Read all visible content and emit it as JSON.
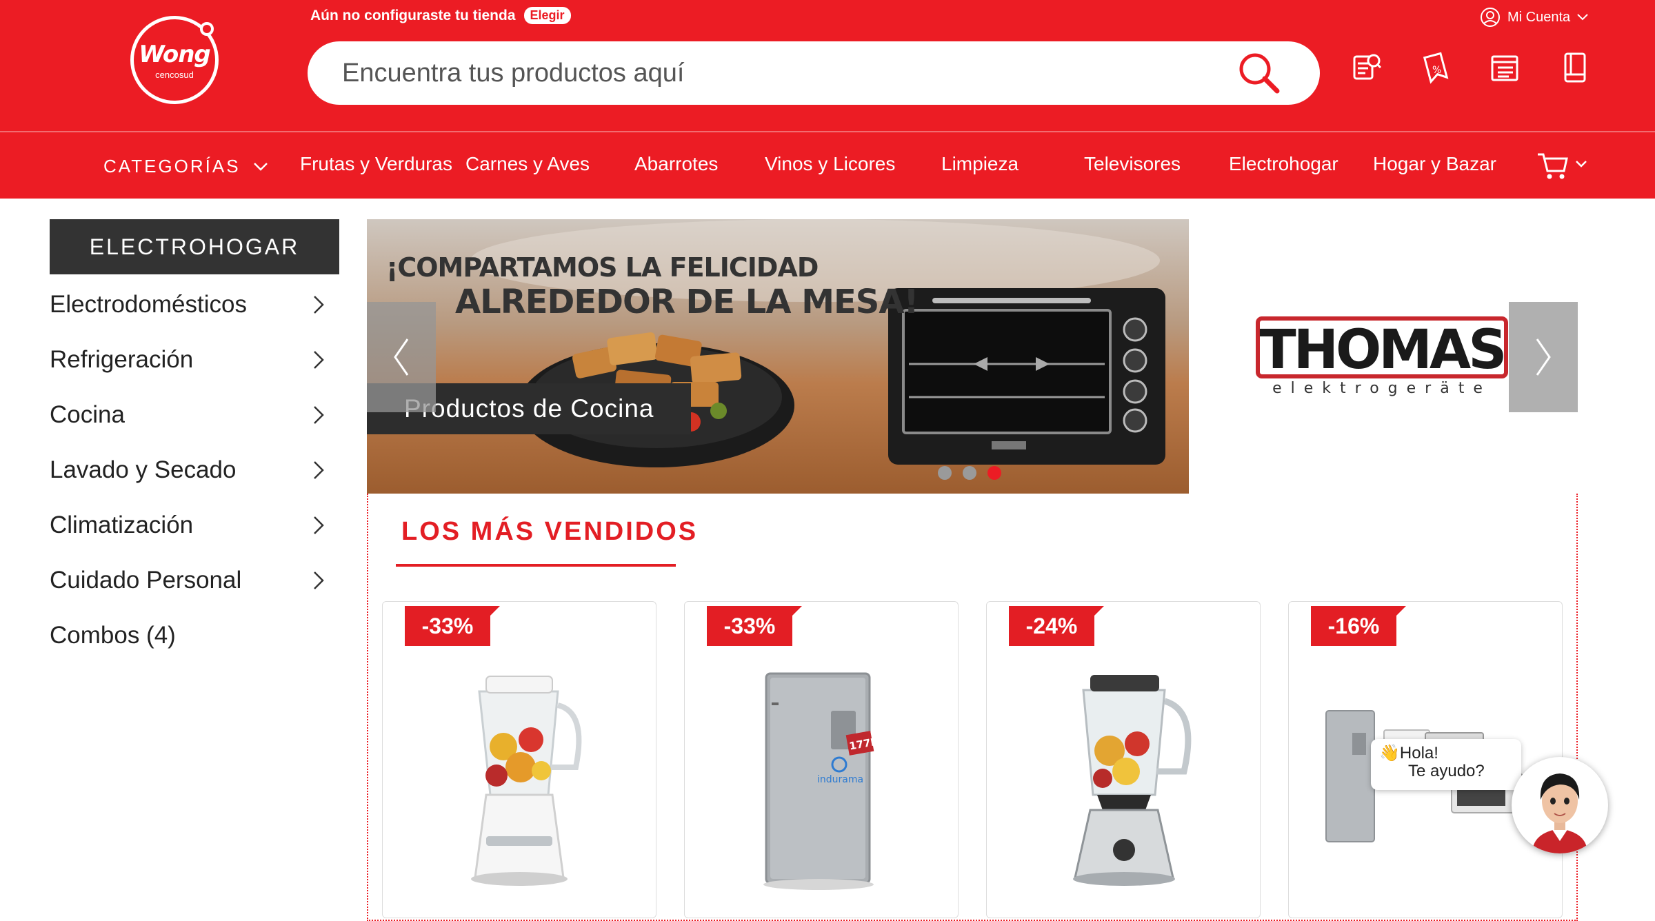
{
  "header": {
    "logo_name": "Wong",
    "logo_sub": "cencosud",
    "store_message": "Aún no configuraste tu tienda",
    "store_button": "Elegir",
    "account_label": "Mi Cuenta",
    "search_placeholder": "Encuentra tus productos aquí",
    "icons": [
      "search-icon",
      "quick-list-icon",
      "offers-icon",
      "orders-icon",
      "catalog-icon"
    ]
  },
  "nav": {
    "categories_label": "CATEGORÍAS",
    "items": [
      "Frutas y Verduras",
      "Carnes y Aves",
      "Abarrotes",
      "Vinos y Licores",
      "Limpieza",
      "Televisores",
      "Electrohogar",
      "Hogar y Bazar"
    ],
    "cart_icon": "cart-icon"
  },
  "sidebar": {
    "title": "ELECTROHOGAR",
    "items": [
      {
        "label": "Electrodomésticos",
        "has_arrow": true
      },
      {
        "label": "Refrigeración",
        "has_arrow": true
      },
      {
        "label": "Cocina",
        "has_arrow": true
      },
      {
        "label": "Lavado y Secado",
        "has_arrow": true
      },
      {
        "label": "Climatización",
        "has_arrow": true
      },
      {
        "label": "Cuidado Personal",
        "has_arrow": true
      },
      {
        "label": "Combos (4)",
        "has_arrow": false
      }
    ]
  },
  "banner": {
    "headline_1": "¡COMPARTAMOS LA FELICIDAD",
    "headline_2": "ALREDEDOR DE LA MESA!",
    "strip_text": "Productos de Cocina",
    "oven_brand": "THOMAS",
    "slides": 3,
    "active_slide": 3
  },
  "brand": {
    "name": "THOMAS",
    "tagline": "elektrogeräte"
  },
  "best_sellers": {
    "title": "LOS MÁS VENDIDOS",
    "products": [
      {
        "discount": "-33%",
        "image": "blender-white"
      },
      {
        "discount": "-33%",
        "image": "refrigerator-silver",
        "capacity_badge": "177L",
        "brand_text": "indurama"
      },
      {
        "discount": "-24%",
        "image": "blender-chrome"
      },
      {
        "discount": "-16%",
        "image": "appliance-combo"
      }
    ]
  },
  "chat": {
    "line1": "Hola!",
    "line2": "Te ayudo?",
    "emoji": "👋"
  },
  "colors": {
    "brand_red": "#ec1c24",
    "dark": "#333333",
    "text": "#222222"
  }
}
